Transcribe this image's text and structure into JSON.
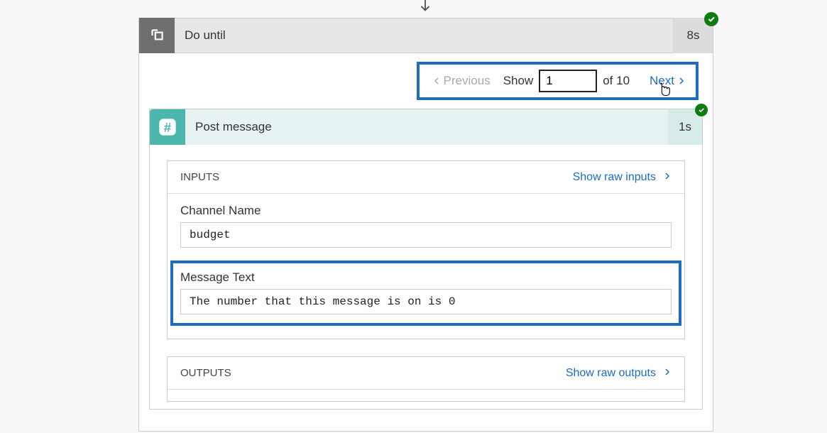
{
  "doUntil": {
    "title": "Do until",
    "duration": "8s"
  },
  "pager": {
    "previousLabel": "Previous",
    "showLabel": "Show",
    "currentValue": "1",
    "ofText": "of 10",
    "nextLabel": "Next"
  },
  "postMessage": {
    "title": "Post message",
    "duration": "1s",
    "inputs": {
      "heading": "INPUTS",
      "showRawLabel": "Show raw inputs",
      "channelName": {
        "label": "Channel Name",
        "value": "budget"
      },
      "messageText": {
        "label": "Message Text",
        "value": "The number that this message is on is 0"
      }
    },
    "outputs": {
      "heading": "OUTPUTS",
      "showRawLabel": "Show raw outputs"
    }
  }
}
